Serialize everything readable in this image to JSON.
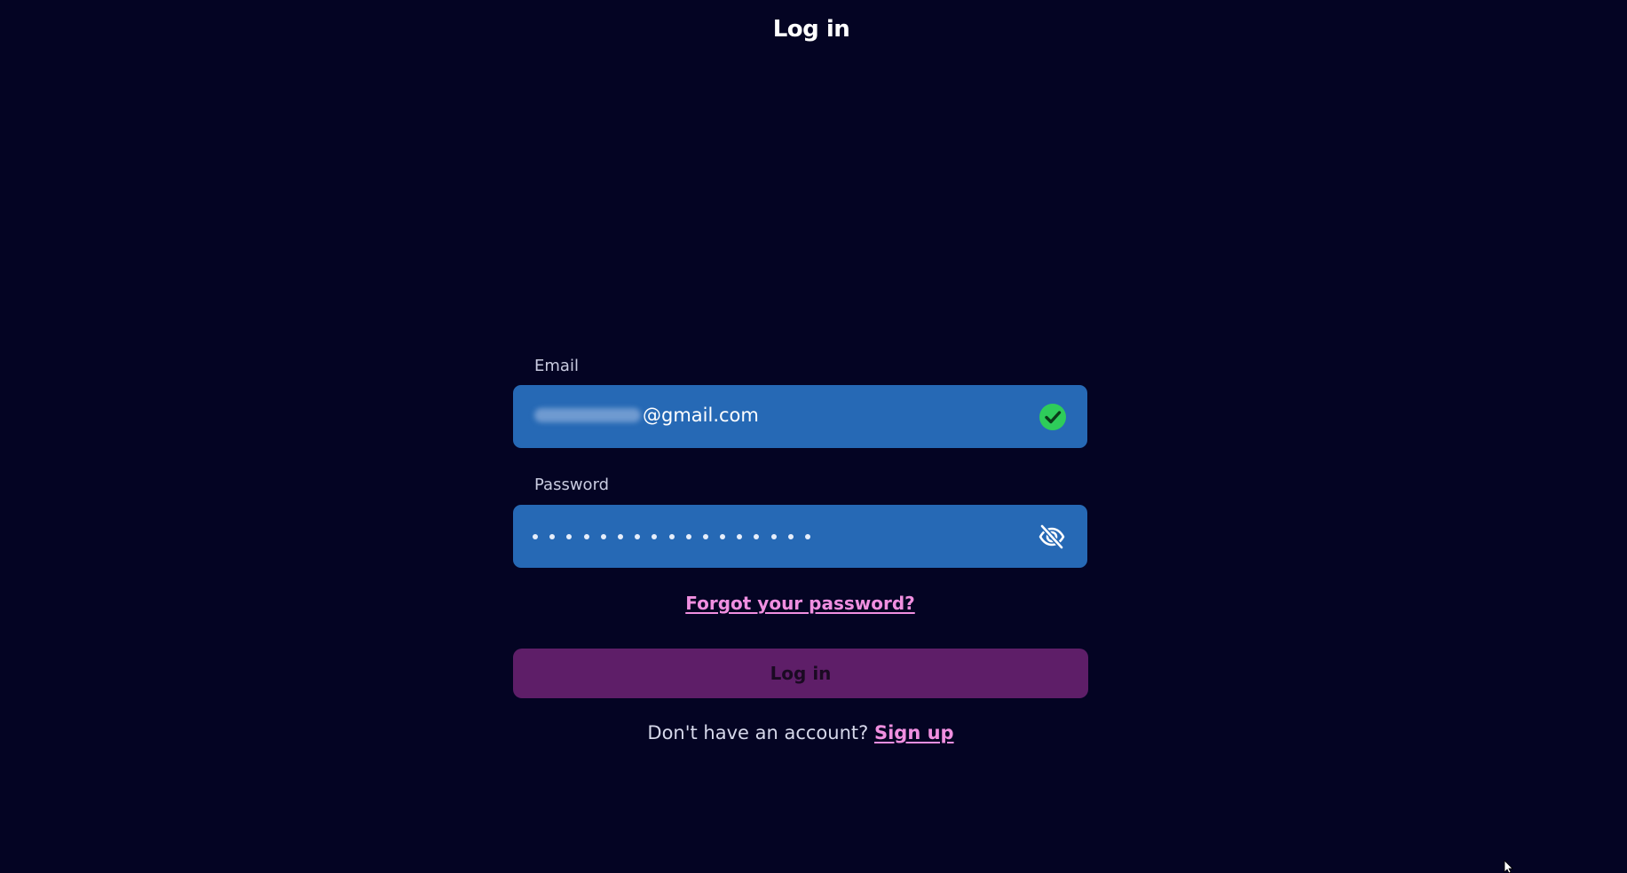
{
  "page": {
    "title": "Log in"
  },
  "email": {
    "label": "Email",
    "value_visible": "@gmail.com",
    "status_icon": "check-circle-icon"
  },
  "password": {
    "label": "Password",
    "masked_length": 17,
    "toggle_icon": "eye-off-icon"
  },
  "links": {
    "forgot_password": "Forgot your password?"
  },
  "actions": {
    "login_label": "Log in"
  },
  "signup": {
    "prompt": "Don't have an account?",
    "link_label": "Sign up"
  },
  "colors": {
    "background": "#040423",
    "field": "#2669b5",
    "accent_link": "#f08fe0",
    "button": "#5e1e68",
    "valid": "#2ecc5a"
  }
}
